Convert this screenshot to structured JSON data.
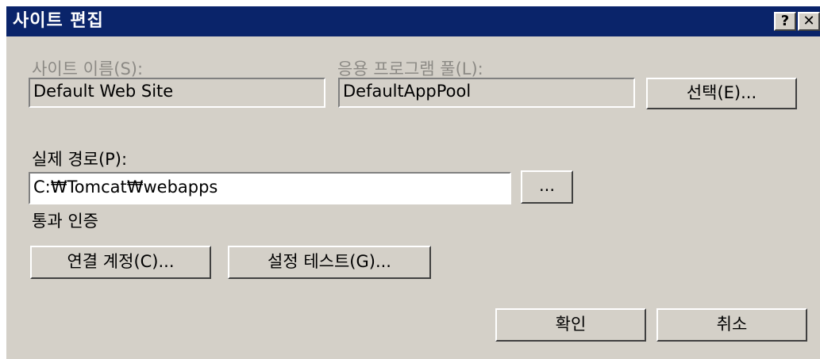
{
  "window": {
    "title": "사이트 편집",
    "help_label": "?",
    "close_label": "✕"
  },
  "site_name": {
    "label": "사이트 이름(S):",
    "value": "Default Web Site"
  },
  "app_pool": {
    "label": "응용 프로그램 풀(L):",
    "value": "DefaultAppPool",
    "select_label": "선택(E)..."
  },
  "physical_path": {
    "label": "실제 경로(P):",
    "value": "C:₩Tomcat₩webapps",
    "browse_label": "..."
  },
  "auth": {
    "label": "통과 인증",
    "connect_as_label": "연결 계정(C)...",
    "test_settings_label": "설정 테스트(G)..."
  },
  "footer": {
    "ok_label": "확인",
    "cancel_label": "취소"
  }
}
